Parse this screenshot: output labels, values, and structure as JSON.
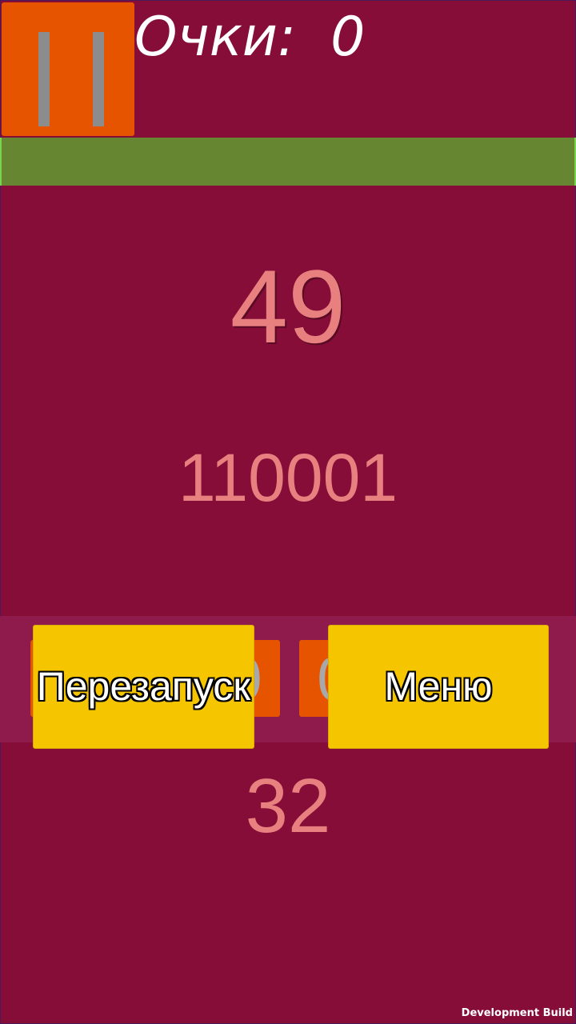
{
  "hud": {
    "score_label": "Очки:  0",
    "pause_icon": "pause-icon"
  },
  "progress": {
    "fraction": 1.0,
    "color": "#668632"
  },
  "puzzle": {
    "target_decimal": "49",
    "target_binary": "110001",
    "current_value": "32"
  },
  "bits": [
    "0",
    "0",
    "0",
    "0",
    "0",
    "0"
  ],
  "overlay": {
    "restart_label": "Перезапуск",
    "menu_label": "Меню"
  },
  "footer": {
    "build_label": "Development Build"
  },
  "colors": {
    "background": "#850d37",
    "button_orange": "#e65400",
    "button_yellow": "#f5c500",
    "number_pink": "#e98080"
  }
}
